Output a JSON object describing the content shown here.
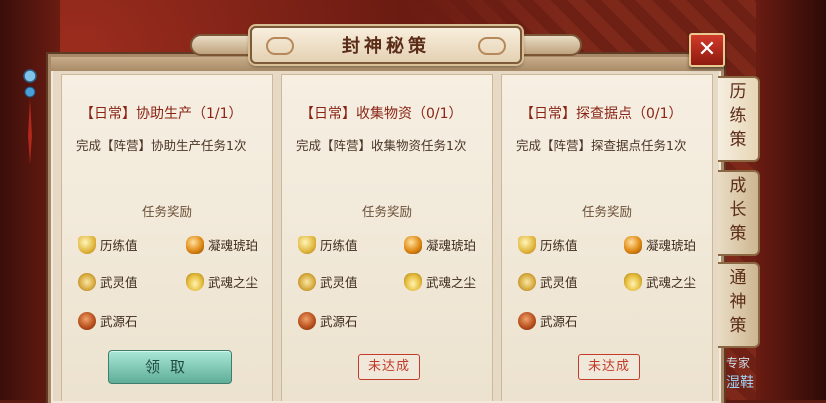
{
  "window": {
    "title": "封神秘策",
    "close_label": "✕"
  },
  "tabs": [
    {
      "label": [
        "历",
        "练",
        "策"
      ],
      "active": true
    },
    {
      "label": [
        "成",
        "长",
        "策"
      ],
      "active": false
    },
    {
      "label": [
        "通",
        "神",
        "策"
      ],
      "active": false
    }
  ],
  "cards": [
    {
      "title": "【日常】协助生产（1/1）",
      "desc": "完成【阵营】协助生产任务1次",
      "reward_heading": "任务奖励",
      "rewards": [
        "历练值",
        "凝魂琥珀",
        "武灵值",
        "武魂之尘",
        "武源石"
      ],
      "action": {
        "type": "button",
        "label": "领取"
      }
    },
    {
      "title": "【日常】收集物资（0/1）",
      "desc": "完成【阵营】收集物资任务1次",
      "reward_heading": "任务奖励",
      "rewards": [
        "历练值",
        "凝魂琥珀",
        "武灵值",
        "武魂之尘",
        "武源石"
      ],
      "action": {
        "type": "stamp",
        "label": "未达成"
      }
    },
    {
      "title": "【日常】探查据点（0/1）",
      "desc": "完成【阵营】探查据点任务1次",
      "reward_heading": "任务奖励",
      "rewards": [
        "历练值",
        "凝魂琥珀",
        "武灵值",
        "武魂之尘",
        "武源石"
      ],
      "action": {
        "type": "stamp",
        "label": "未达成"
      }
    }
  ],
  "footer": {
    "line1": "专家",
    "line2": "湿鞋"
  }
}
